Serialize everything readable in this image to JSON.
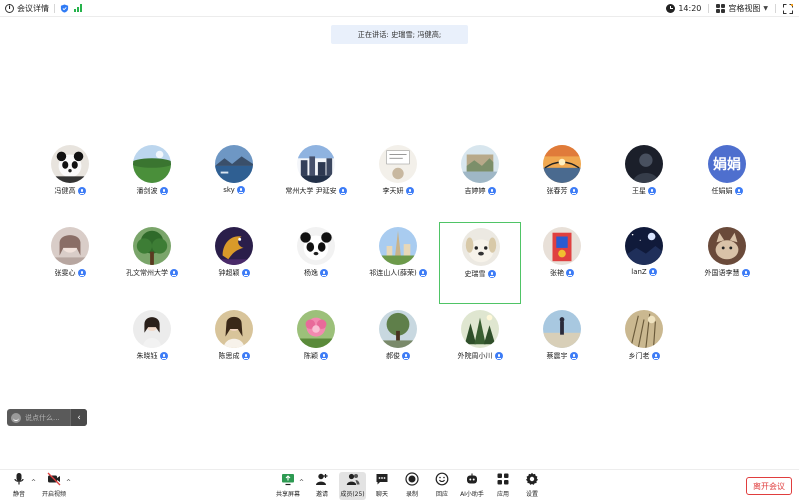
{
  "topbar": {
    "meeting_info": "会议详情",
    "time": "14:20",
    "view_mode": "宫格视图"
  },
  "speaking_banner": "正在讲话: 史瑞雪; 冯健高;",
  "participants": [
    {
      "name": "冯健高",
      "avatar": "panda-photo"
    },
    {
      "name": "潘剑波",
      "avatar": "field-photo"
    },
    {
      "name": "sky",
      "avatar": "lake-photo"
    },
    {
      "name": "常州大学 尹延安",
      "avatar": "city-photo"
    },
    {
      "name": "李天妍",
      "avatar": "sketch-photo"
    },
    {
      "name": "吉婷婷",
      "avatar": "painting-photo"
    },
    {
      "name": "张春芳",
      "avatar": "sunset-bridge-photo"
    },
    {
      "name": "王星",
      "avatar": "dark-portrait-photo"
    },
    {
      "name": "任娟娟",
      "avatar": "text",
      "avatar_text": "娟娟"
    },
    {
      "name": "张雯心",
      "avatar": "anime-photo"
    },
    {
      "name": "孔文常州大学",
      "avatar": "tree-photo"
    },
    {
      "name": "钟超颖",
      "avatar": "dragon-photo"
    },
    {
      "name": "杨逸",
      "avatar": "panda2-photo"
    },
    {
      "name": "祁连山人(薛荣)",
      "avatar": "landmark-photo"
    },
    {
      "name": "史瑞雪",
      "avatar": "dog-photo"
    },
    {
      "name": "张艳",
      "avatar": "art-photo"
    },
    {
      "name": "lanZ",
      "avatar": "night-photo"
    },
    {
      "name": "外国语李慧",
      "avatar": "cat-photo"
    },
    {
      "name": "朱晓钰",
      "avatar": "girl-photo"
    },
    {
      "name": "陈思成",
      "avatar": "woman-photo"
    },
    {
      "name": "陈颖",
      "avatar": "flower-photo"
    },
    {
      "name": "郝俊",
      "avatar": "tree2-photo"
    },
    {
      "name": "外院周小川",
      "avatar": "forest-photo"
    },
    {
      "name": "蔡震宇",
      "avatar": "beach-photo"
    },
    {
      "name": "乡门老",
      "avatar": "reed-photo"
    }
  ],
  "chat": {
    "placeholder": "说点什么..."
  },
  "toolbar": {
    "mute": "静音",
    "video": "开启视频",
    "share": "共享屏幕",
    "invite": "邀请",
    "members": "成员(25)",
    "chat": "聊天",
    "record": "录制",
    "replay": "回应",
    "ai": "AI小助手",
    "apps": "应用",
    "settings": "设置",
    "leave": "离开会议"
  },
  "colors": {
    "accent": "#3d7cf6",
    "active_border": "#4fc466",
    "leave": "#e03e3e",
    "banner_bg": "#e9f0fb"
  }
}
